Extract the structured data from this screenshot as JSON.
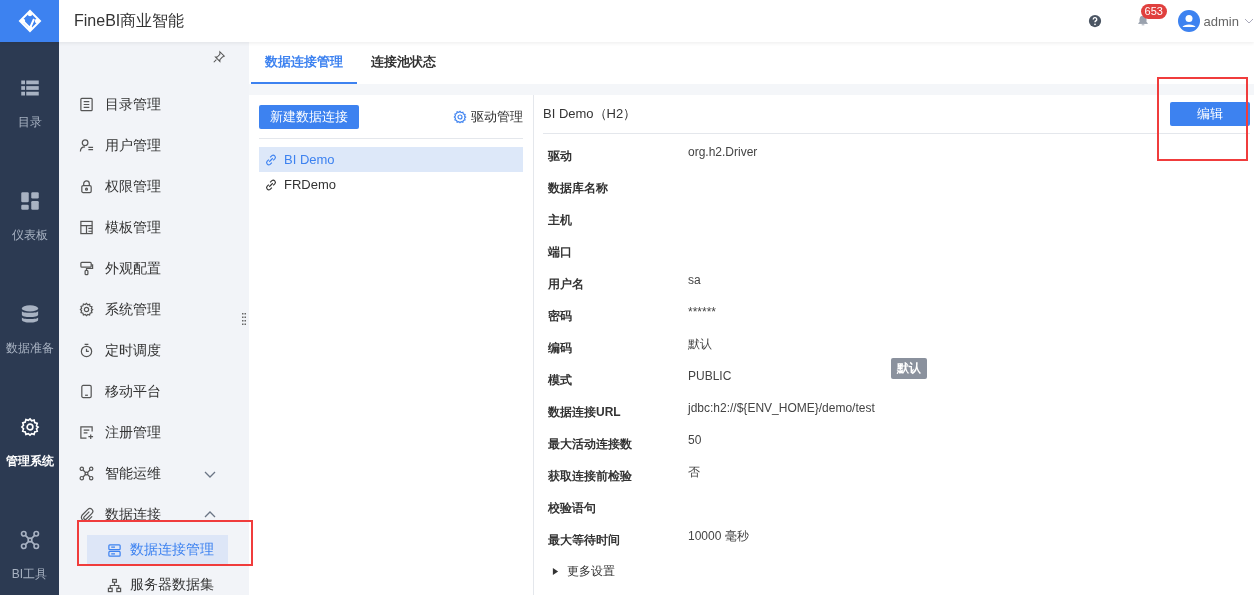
{
  "app": {
    "title": "FineBI商业智能",
    "notifications": "653",
    "user": "admin"
  },
  "rail": [
    {
      "label": "目录",
      "kind": "list",
      "selected": false
    },
    {
      "label": "仪表板",
      "kind": "grid",
      "selected": false
    },
    {
      "label": "数据准备",
      "kind": "db",
      "selected": false
    },
    {
      "label": "管理系统",
      "kind": "gear",
      "selected": true
    },
    {
      "label": "BI工具",
      "kind": "nodes",
      "selected": false
    }
  ],
  "menu": [
    {
      "label": "目录管理",
      "kind": "doc"
    },
    {
      "label": "用户管理",
      "kind": "user"
    },
    {
      "label": "权限管理",
      "kind": "lock"
    },
    {
      "label": "模板管理",
      "kind": "tpl"
    },
    {
      "label": "外观配置",
      "kind": "brush"
    },
    {
      "label": "系统管理",
      "kind": "gear"
    },
    {
      "label": "定时调度",
      "kind": "timer"
    },
    {
      "label": "移动平台",
      "kind": "phone"
    },
    {
      "label": "注册管理",
      "kind": "reg"
    },
    {
      "label": "智能运维",
      "kind": "nodes",
      "expanded": false
    },
    {
      "label": "数据连接",
      "kind": "clip",
      "expanded": true,
      "children": [
        {
          "label": "数据连接管理",
          "kind": "server",
          "selected": true
        },
        {
          "label": "服务器数据集",
          "kind": "tree",
          "selected": false
        }
      ]
    }
  ],
  "tabs": [
    {
      "label": "数据连接管理",
      "selected": true
    },
    {
      "label": "连接池状态",
      "selected": false
    }
  ],
  "connections": {
    "new_button": "新建数据连接",
    "driver_button": "驱动管理",
    "items": [
      {
        "name": "BI Demo",
        "selected": true
      },
      {
        "name": "FRDemo",
        "selected": false
      }
    ]
  },
  "detail": {
    "title": "BI Demo（H2）",
    "edit_button": "编辑",
    "fields": [
      {
        "label": "驱动",
        "value": "org.h2.Driver"
      },
      {
        "label": "数据库名称"
      },
      {
        "label": "主机"
      },
      {
        "label": "端口"
      },
      {
        "label": "用户名",
        "value": "sa"
      },
      {
        "label": "密码",
        "value": "******"
      },
      {
        "label": "编码",
        "value": "默认"
      },
      {
        "label": "模式",
        "value": "PUBLIC"
      },
      {
        "label": "数据连接URL",
        "value": "jdbc:h2://${ENV_HOME}/demo/test"
      },
      {
        "label": "最大活动连接数",
        "value": "50"
      },
      {
        "label": "获取连接前检验",
        "value": "否"
      },
      {
        "label": "校验语句"
      },
      {
        "label": "最大等待时间",
        "value": "10000 毫秒"
      }
    ],
    "more": "更多设置",
    "tooltip": "默认"
  }
}
